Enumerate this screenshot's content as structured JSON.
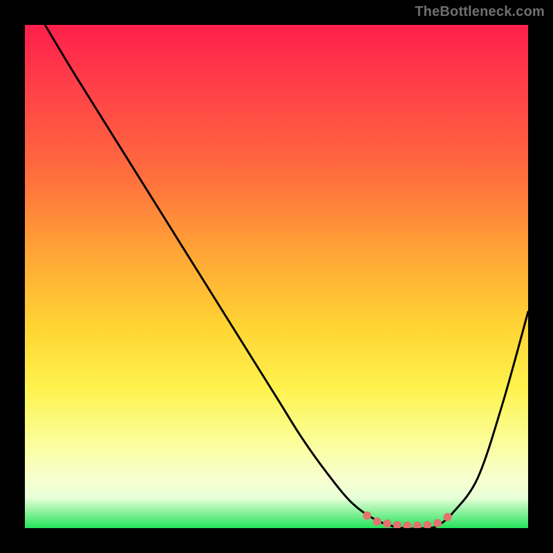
{
  "watermark": {
    "text": "TheBottleneck.com"
  },
  "chart_data": {
    "type": "line",
    "title": "",
    "xlabel": "",
    "ylabel": "",
    "ylim": [
      0,
      100
    ],
    "xlim": [
      0,
      100
    ],
    "series": [
      {
        "name": "curve",
        "x": [
          4,
          10,
          20,
          30,
          40,
          50,
          55,
          60,
          65,
          70,
          75,
          80,
          82,
          85,
          90,
          95,
          100
        ],
        "values": [
          100,
          90,
          74,
          58,
          42,
          26,
          18,
          11,
          5,
          1.5,
          0,
          0,
          0.5,
          3,
          10,
          25,
          43
        ]
      }
    ],
    "markers": {
      "color": "#e2736f",
      "points": [
        {
          "x": 68,
          "y": 2.5
        },
        {
          "x": 70,
          "y": 1.3
        },
        {
          "x": 72,
          "y": 0.9
        },
        {
          "x": 74,
          "y": 0.6
        },
        {
          "x": 76,
          "y": 0.5
        },
        {
          "x": 78,
          "y": 0.5
        },
        {
          "x": 80,
          "y": 0.6
        },
        {
          "x": 82,
          "y": 1.0
        },
        {
          "x": 84,
          "y": 2.2
        }
      ]
    }
  }
}
